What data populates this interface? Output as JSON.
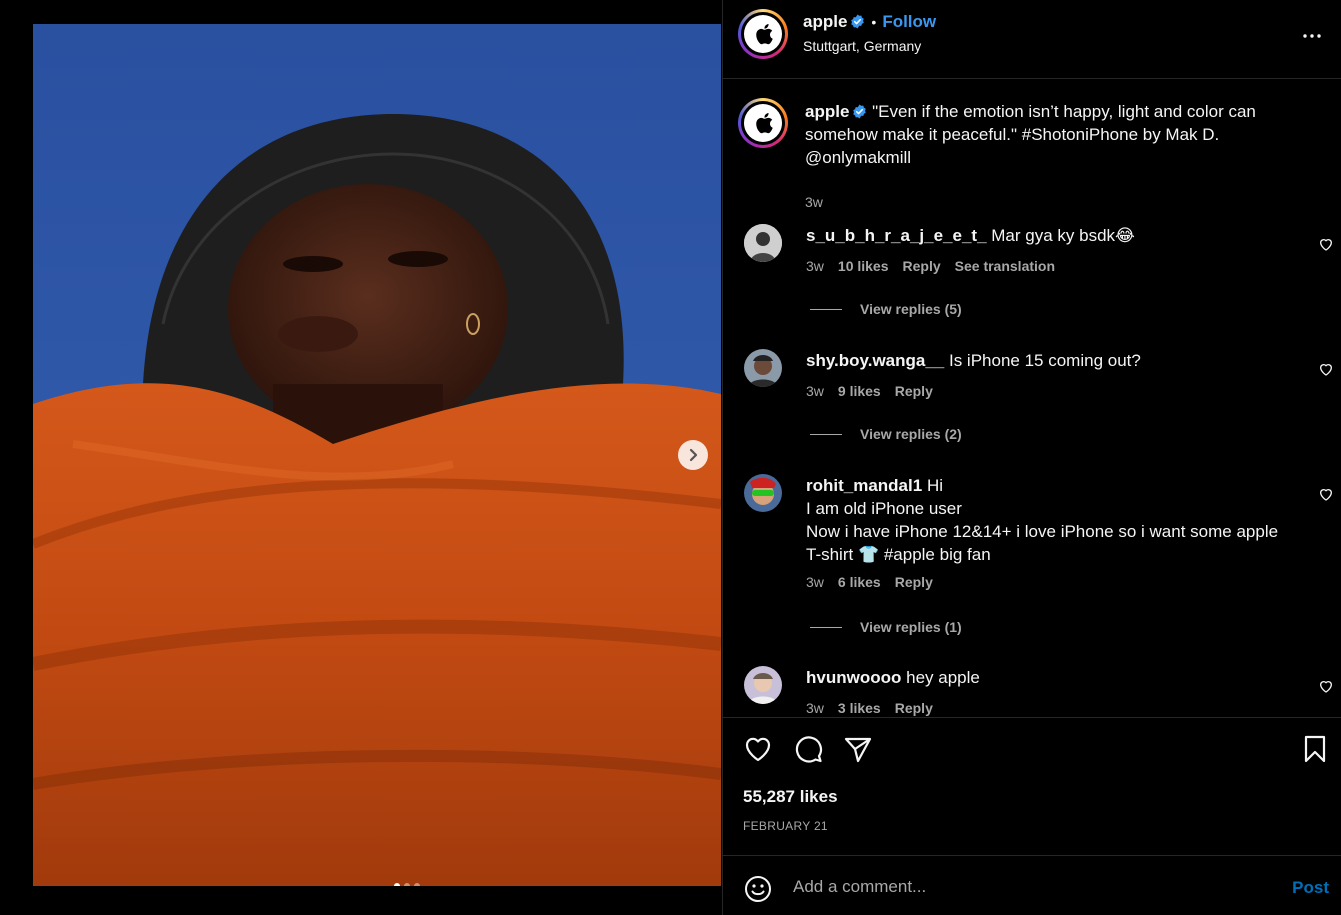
{
  "post": {
    "image_alt": "Man wearing black bucket hat and orange knit sweater against blue sky",
    "carousel_dots": 3,
    "active_dot": 0
  },
  "header": {
    "username": "apple",
    "follow_label": "Follow",
    "separator": "•",
    "location": "Stuttgart, Germany"
  },
  "caption": {
    "username": "apple",
    "text": "\"Even if the emotion isn’t happy, light and color can somehow make it peaceful.\" #ShotoniPhone by Mak D. @onlymakmill",
    "time": "3w"
  },
  "comments": [
    {
      "username": "s_u_b_h_r_a_j_e_e_t_",
      "text": "Mar gya ky bsdk😂",
      "time": "3w",
      "likes": "10 likes",
      "reply_label": "Reply",
      "translation_label": "See translation",
      "view_replies": "View replies (5)"
    },
    {
      "username": "shy.boy.wanga__",
      "text": "Is iPhone 15 coming out?",
      "time": "3w",
      "likes": "9 likes",
      "reply_label": "Reply",
      "view_replies": "View replies (2)"
    },
    {
      "username": "rohit_mandal1",
      "text": "Hi\nI am old iPhone user\nNow i have iPhone 12&14+ i love iPhone so i want some apple T-shirt 👕 #apple big fan",
      "time": "3w",
      "likes": "6 likes",
      "reply_label": "Reply",
      "view_replies": "View replies (1)"
    },
    {
      "username": "hvunwoooo",
      "text": "hey apple",
      "time": "3w",
      "likes": "3 likes",
      "reply_label": "Reply"
    }
  ],
  "actions": {
    "likes_count": "55,287 likes",
    "date": "FEBRUARY 21"
  },
  "add_comment": {
    "placeholder": "Add a comment...",
    "post_label": "Post"
  },
  "colors": {
    "background": "#000000",
    "link": "#3897f0",
    "post_button": "#0095f6",
    "secondary_text": "#a8a8a8"
  }
}
